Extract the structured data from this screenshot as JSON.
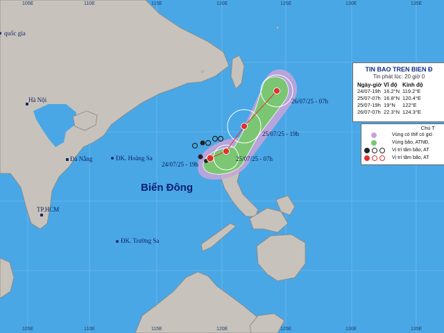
{
  "map": {
    "longitude_ticks": [
      "105E",
      "110E",
      "115E",
      "120E",
      "125E",
      "130E",
      "135E"
    ],
    "place_labels": {
      "country": "quốc gia",
      "hanoi": "Hà Nội",
      "danang": "Đà Nẵng",
      "hcm": "TP.HCM",
      "hoangsa": "ĐK. Hoàng Sa",
      "truongsa": "ĐK. Trường Sa",
      "sea": "Biển Đông"
    },
    "track_labels": [
      "24/07/25 - 19h",
      "25/07/25 - 07h",
      "25/07/25 - 19h",
      "26/07/25 - 07h"
    ],
    "colors": {
      "sea": "#49a7e6",
      "land": "#c7c2bb",
      "coast": "#8a8580",
      "forecast_cone": "#78c86e",
      "uncertainty_cone": "#c9a3d8",
      "storm_symbol": "#e03030"
    }
  },
  "panel": {
    "title": "TIN BAO TREN BIEN Đ",
    "issued": "Tin phát lúc: 20 giờ 0",
    "headers": [
      "Ngày-giờ",
      "Vĩ độ",
      "Kinh độ"
    ],
    "rows": [
      [
        "24/07-19h",
        "16.2°N",
        "119.2°E"
      ],
      [
        "25/07-07h",
        "16.8°N",
        "120.4°E"
      ],
      [
        "25/07-19h",
        "19°N",
        "122°E"
      ],
      [
        "26/07-07h",
        "22.3°N",
        "124.3°E"
      ]
    ]
  },
  "legend": {
    "title": "Chú T",
    "items": [
      {
        "text": "Vùng có thể có gió",
        "icon": "purple-circle"
      },
      {
        "text": "Vùng bão, ATNĐ,",
        "icon": "green-circle"
      },
      {
        "text": "Vị trí tâm bão, AT",
        "icon": "black-storm-symbols"
      },
      {
        "text": "Vị trí tâm bão, AT",
        "icon": "red-storm-symbols"
      }
    ]
  }
}
